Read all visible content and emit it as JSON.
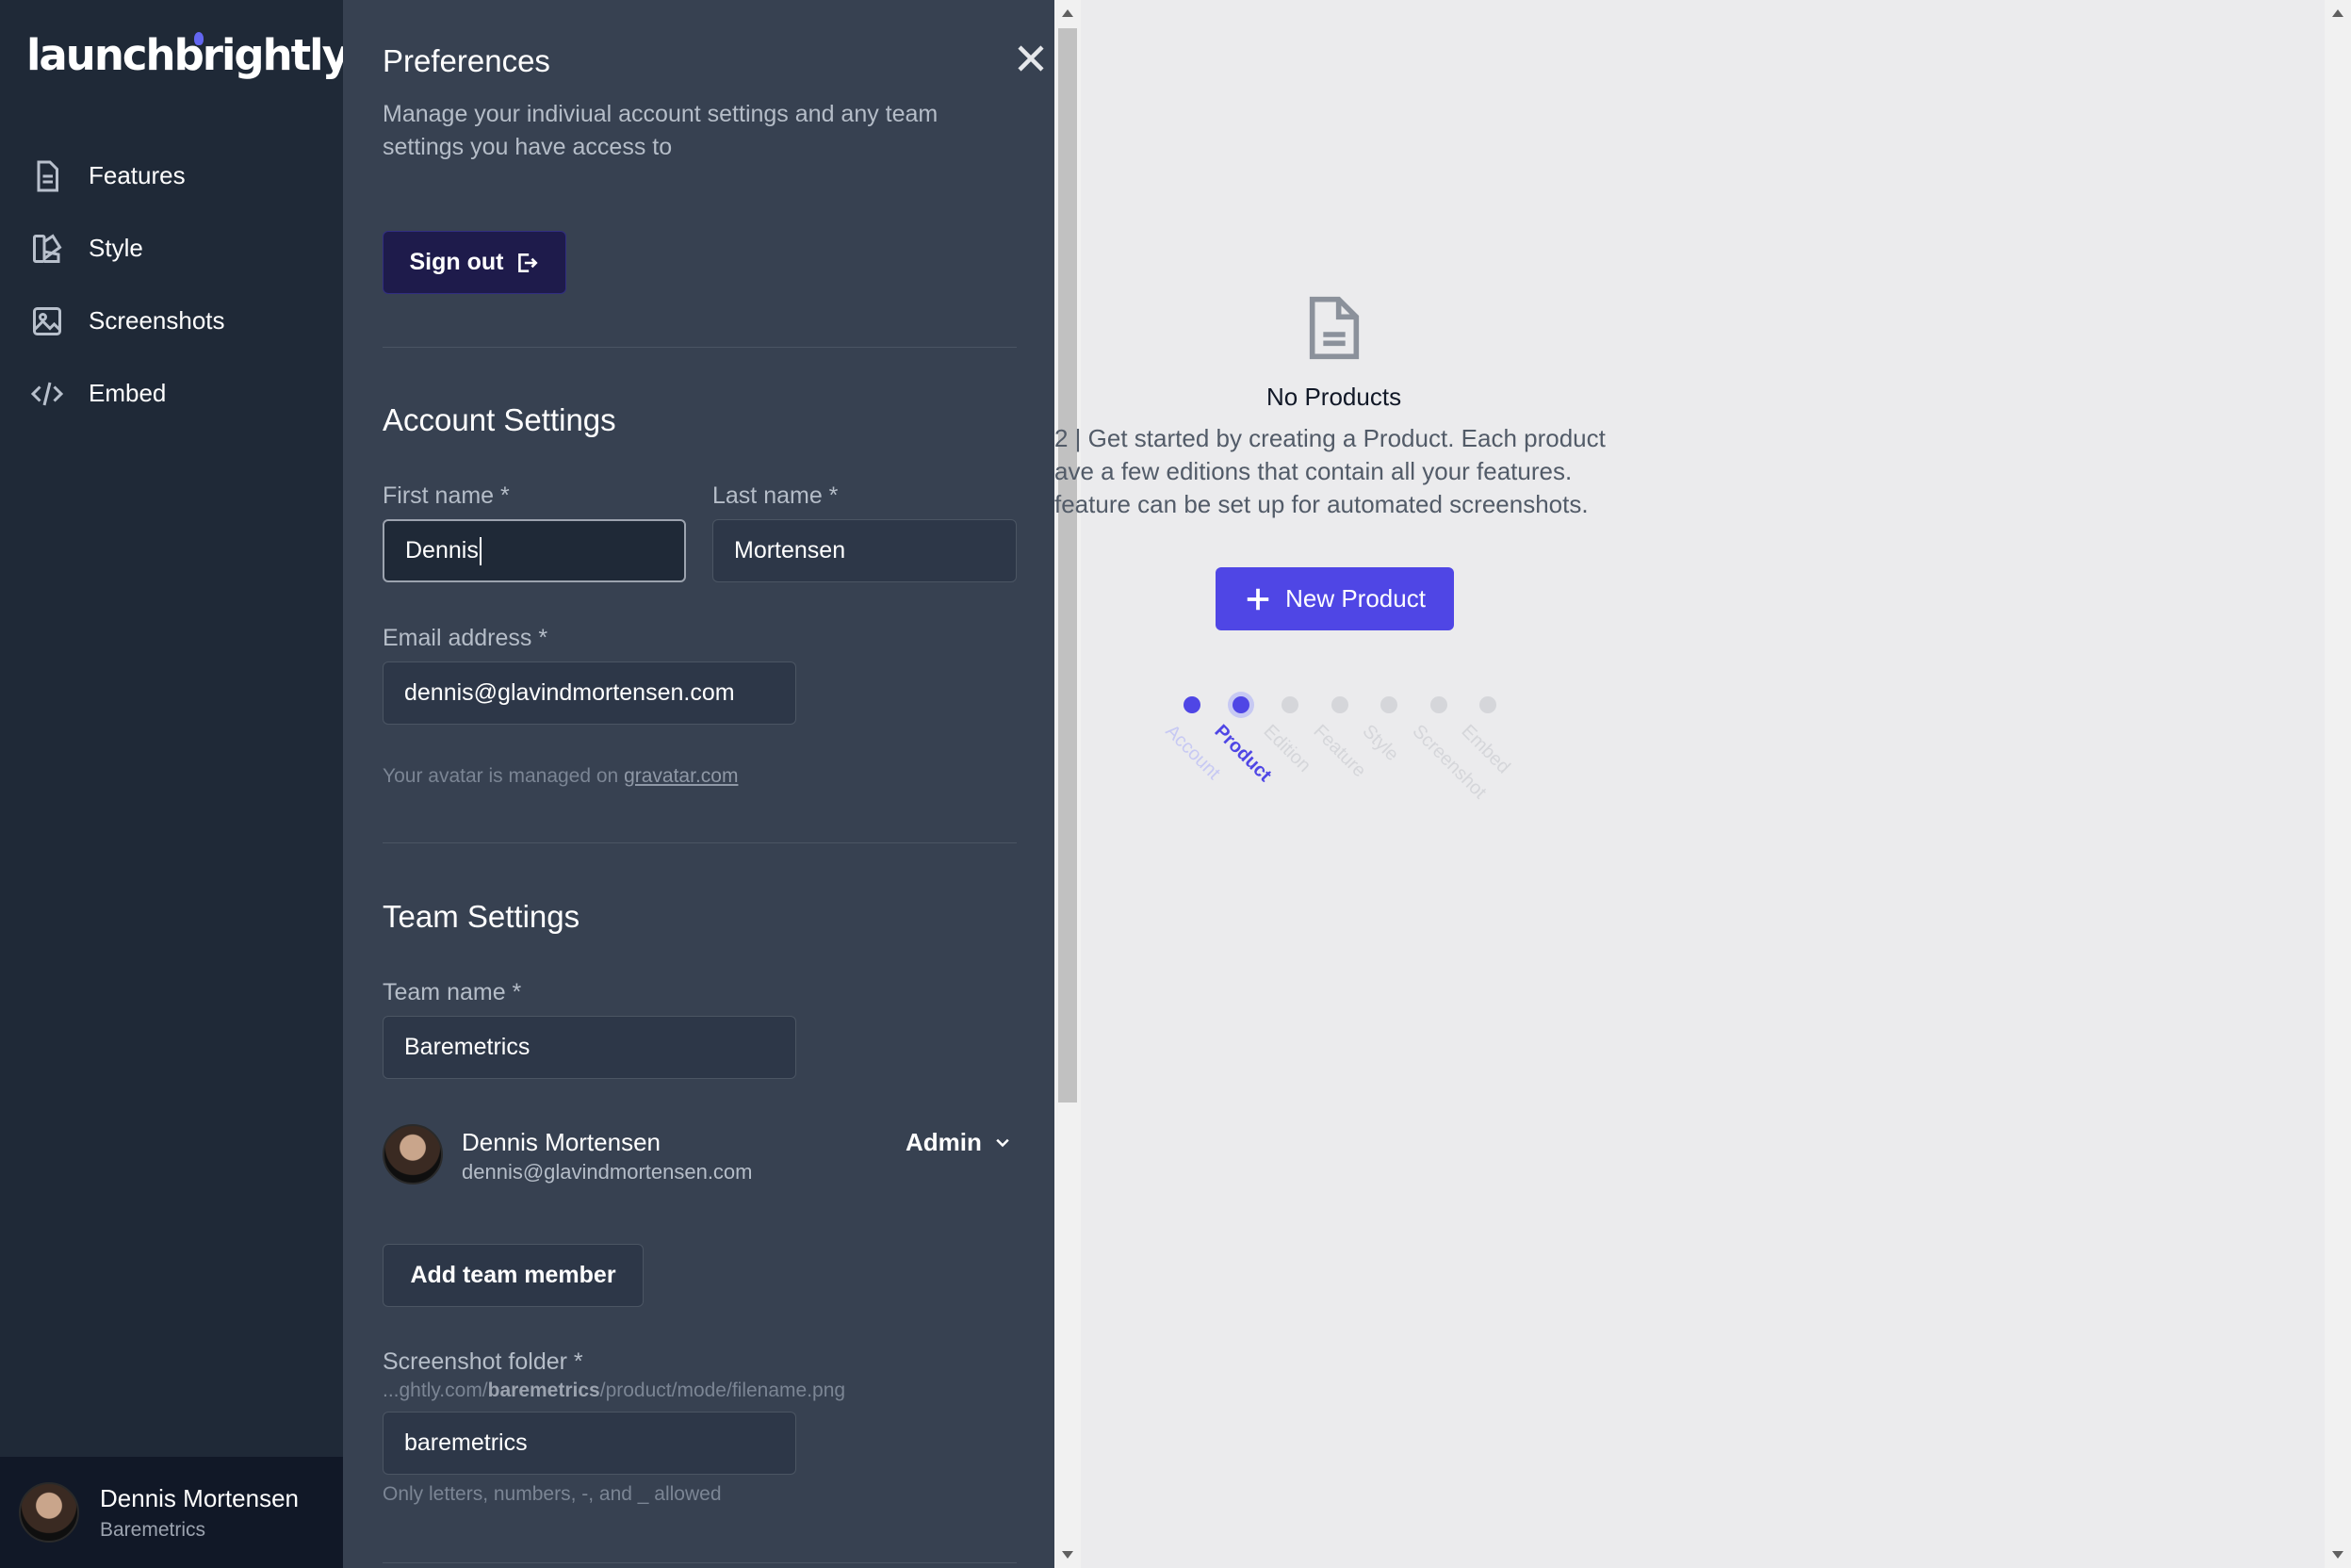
{
  "app": {
    "logo": "launchbrightly"
  },
  "sidebar": {
    "items": [
      {
        "label": "Features",
        "icon": "document-icon"
      },
      {
        "label": "Style",
        "icon": "style-icon"
      },
      {
        "label": "Screenshots",
        "icon": "image-icon"
      },
      {
        "label": "Embed",
        "icon": "code-icon"
      }
    ],
    "user": {
      "name": "Dennis Mortensen",
      "team": "Baremetrics"
    }
  },
  "preferences": {
    "title": "Preferences",
    "subtitle": "Manage your indiviual account settings and any team settings you have access to",
    "sign_out_label": "Sign out",
    "account": {
      "title": "Account Settings",
      "first_name_label": "First name *",
      "first_name_value": "Dennis",
      "last_name_label": "Last name *",
      "last_name_value": "Mortensen",
      "email_label": "Email address *",
      "email_value": "dennis@glavindmortensen.com",
      "avatar_hint": "Your avatar is managed on ",
      "avatar_link": "gravatar.com"
    },
    "team": {
      "title": "Team Settings",
      "team_name_label": "Team name *",
      "team_name_value": "Baremetrics",
      "member": {
        "name": "Dennis Mortensen",
        "email": "dennis@glavindmortensen.com",
        "role": "Admin"
      },
      "add_member_label": "Add team member",
      "folder_label": "Screenshot folder *",
      "folder_path_prefix": "...ghtly.com/",
      "folder_path_bold": "baremetrics",
      "folder_path_suffix": "/product/mode/filename.png",
      "folder_value": "baremetrics",
      "folder_hint": "Only letters, numbers, -, and _ allowed"
    }
  },
  "main": {
    "empty_title": "No Products",
    "empty_desc": "2 | Get started by creating a Product. Each product\nave a few editions that contain all your features.\nfeature can be set up for automated screenshots.",
    "new_product_label": "New Product",
    "steps": [
      {
        "label": "Account",
        "state": "done"
      },
      {
        "label": "Product",
        "state": "current"
      },
      {
        "label": "Edition",
        "state": "todo"
      },
      {
        "label": "Feature",
        "state": "todo"
      },
      {
        "label": "Style",
        "state": "todo"
      },
      {
        "label": "Screenshot",
        "state": "todo"
      },
      {
        "label": "Embed",
        "state": "todo"
      }
    ]
  },
  "colors": {
    "accent": "#4f46e5",
    "sidebar": "#1f2937",
    "panel": "#374151"
  }
}
